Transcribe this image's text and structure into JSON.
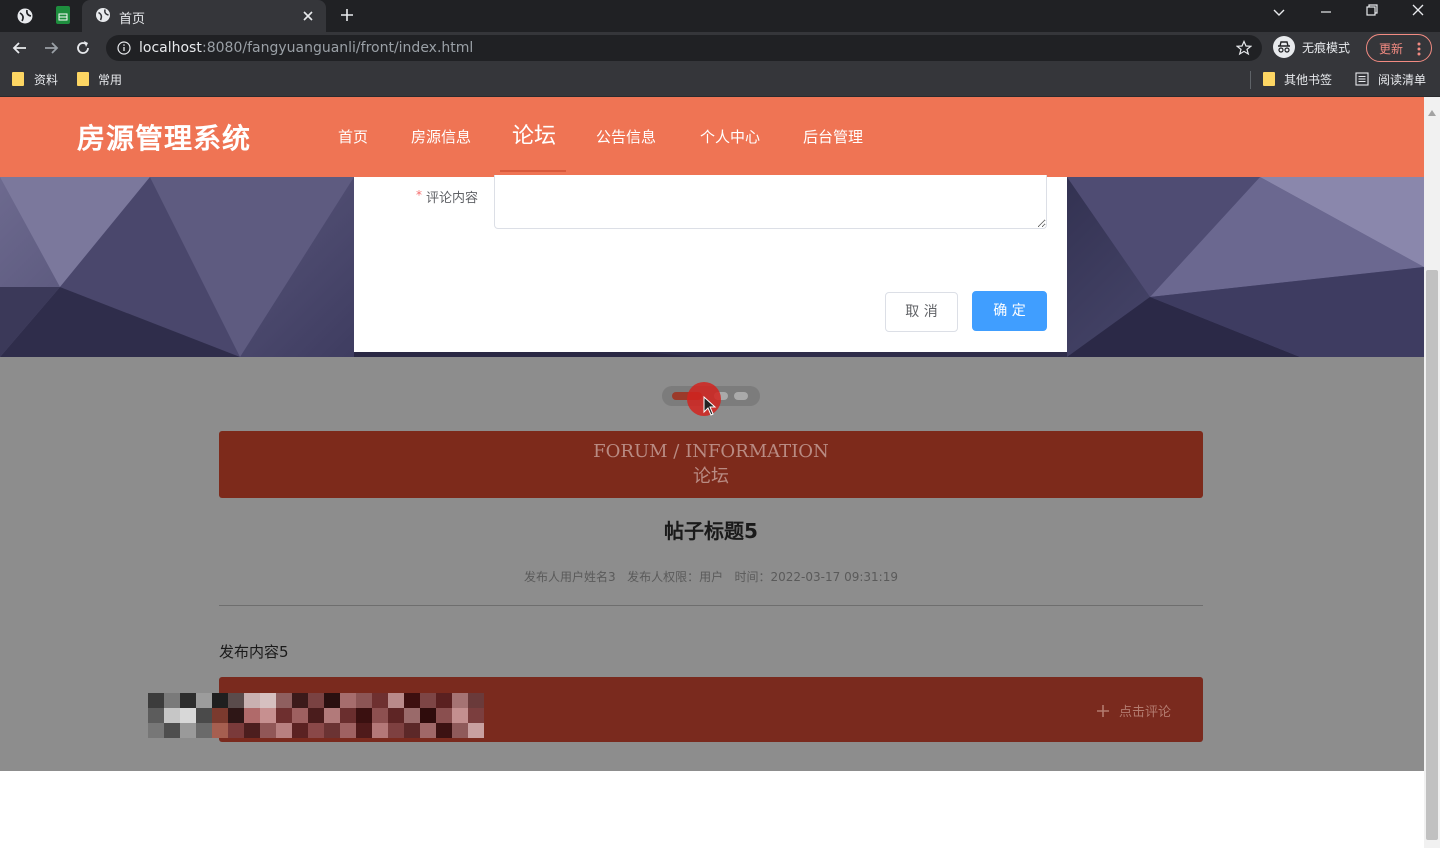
{
  "browser": {
    "tab_title": "首页",
    "url_host": "localhost",
    "url_rest": ":8080/fangyuanguanli/front/index.html",
    "incognito_label": "无痕模式",
    "update_label": "更新",
    "bookmarks": [
      "资料",
      "常用"
    ],
    "other_bookmarks": "其他书签",
    "reading_list": "阅读清单"
  },
  "site": {
    "logo": "房源管理系统",
    "nav": [
      "首页",
      "房源信息",
      "论坛",
      "公告信息",
      "个人中心",
      "后台管理"
    ],
    "active_nav": "论坛"
  },
  "dialog": {
    "required_mark": "*",
    "comment_label": "评论内容",
    "comment_value": "",
    "cancel_label": "取 消",
    "confirm_label": "确 定"
  },
  "forum": {
    "banner_en": "FORUM / INFORMATION",
    "banner_cn": "论坛",
    "post_title": "帖子标题5",
    "post_meta": "发布人用户姓名3   发布人权限：用户   时间：2022-03-17 09:31:19",
    "post_content": "发布内容5",
    "add_comment_label": "点击评论"
  },
  "colors": {
    "header": "#ef7454",
    "primary_button": "#409eff",
    "required": "#f56c6c"
  }
}
